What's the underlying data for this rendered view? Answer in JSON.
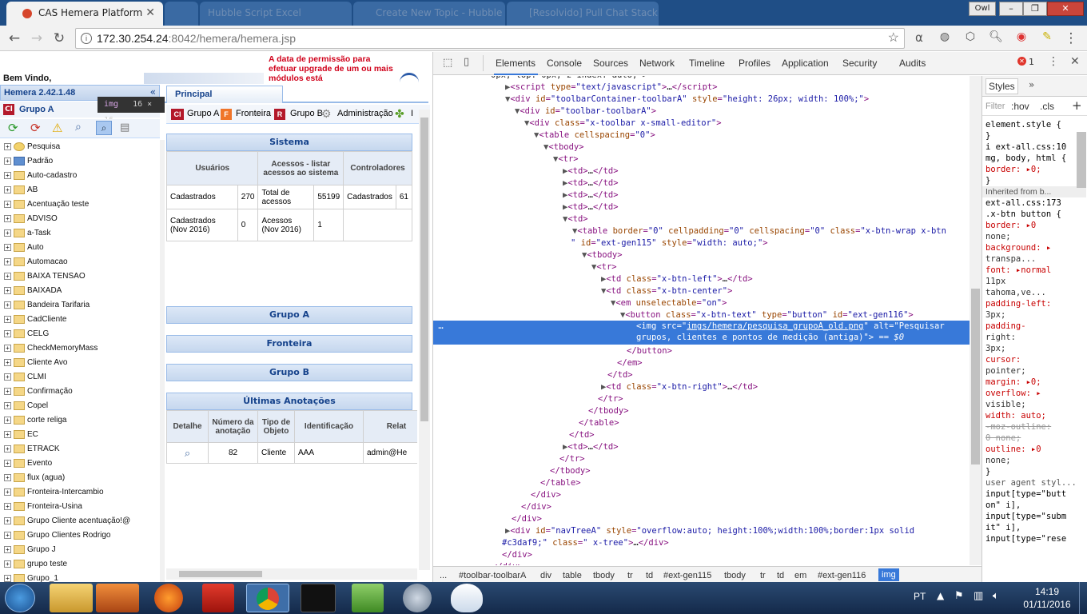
{
  "browser": {
    "active_tab": "CAS Hemera Platform",
    "inactive_tabs": [
      "",
      "Hubble Script Excel",
      "Create New Topic - Hubble",
      "[Resolvido] Pull Chat Stack"
    ],
    "profile_name": "Owl",
    "url_host": "172.30.254.24",
    "url_rest": ":8042/hemera/hemera.jsp"
  },
  "app": {
    "welcome": "Bem Vindo,",
    "version": "Hemera 2.42.1.48",
    "notice": "A data de permissão para efetuar upgrade de um ou mais módulos está",
    "group_title": "Grupo A",
    "tooltip_tag": "img",
    "tooltip_size": "16 × 16",
    "tree_items": [
      "Pesquisa",
      "Padrão",
      "Auto-cadastro",
      "AB",
      "Acentuação teste",
      "ADVISO",
      "a-Task",
      "Auto",
      "Automacao",
      "BAIXA TENSAO",
      "BAIXADA",
      "Bandeira Tarifaria",
      "CadCliente",
      "CELG",
      "CheckMemoryMass",
      "Cliente Avo",
      "CLMI",
      "Confirmação",
      "Copel",
      "corte religa",
      "EC",
      "ETRACK",
      "Evento",
      "flux (agua)",
      "Fronteira-Intercambio",
      "Fronteira-Usina",
      "Grupo Cliente acentuação!@",
      "Grupo Clientes Rodrigo",
      "Grupo J",
      "grupo teste",
      "Grupo_1"
    ],
    "main_tab": "Principal",
    "toolbar": [
      "Grupo A",
      "Fronteira",
      "Grupo B",
      "Administração",
      "I"
    ],
    "sistema": {
      "title": "Sistema",
      "headers": [
        "Usuários",
        "Acessos - listar acessos ao sistema",
        "Controladores"
      ],
      "row1": [
        "Cadastrados",
        "270",
        "Total de acessos",
        "55199",
        "Cadastrados",
        "61"
      ],
      "row2": [
        "Cadastrados (Nov 2016)",
        "0",
        "Acessos (Nov 2016)",
        "1"
      ]
    },
    "panels": [
      "Grupo A",
      "Fronteira",
      "Grupo B"
    ],
    "anotacoes": {
      "title": "Últimas Anotações",
      "headers": [
        "Detalhe",
        "Número da anotação",
        "Tipo de Objeto",
        "Identificação",
        "Relat"
      ],
      "row": [
        "82",
        "Cliente",
        "AAA",
        "admin@He"
      ]
    }
  },
  "devtools": {
    "tabs": [
      "Elements",
      "Console",
      "Sources",
      "Network",
      "Timeline",
      "Profiles",
      "Application",
      "Security",
      "Audits"
    ],
    "error_count": "1",
    "breadcrumbs": [
      "...",
      "#toolbar-toolbarA",
      "div",
      "table",
      "tbody",
      "tr",
      "td",
      "#ext-gen115",
      "tbody",
      "tr",
      "td",
      "em",
      "#ext-gen116",
      "img"
    ],
    "styles_tab": "Styles",
    "filter_placeholder": "Filter",
    "hov": ":hov",
    "cls": ".cls",
    "styles_lines": [
      "element.style {",
      "}",
      "i ext-all.css:10",
      "mg, body, html {",
      "  border: ▸0;",
      "}",
      "Inherited from  b...",
      "ext-all.css:173",
      ".x-btn button {",
      "  border: ▸0",
      "    none;",
      "  background: ▸",
      "    transpa...",
      "  font: ▸normal",
      "    11px",
      "    tahoma,ve...",
      "  padding-left:",
      "    3px;",
      "  padding-",
      "    right:",
      "    3px;",
      "  cursor:",
      "    pointer;",
      "  margin: ▸0;",
      "  overflow: ▸",
      "    visible;",
      "  width: auto;",
      "  -moz-outline:",
      "    0 none;",
      "  outline: ▸0",
      "    none;",
      "}",
      "user agent styl...",
      "input[type=\"butt",
      "on\" i],",
      "input[type=\"subm",
      "it\" i],",
      "input[type=\"rese"
    ]
  },
  "taskbar": {
    "lang": "PT",
    "time": "14:19",
    "date": "01/11/2016"
  }
}
